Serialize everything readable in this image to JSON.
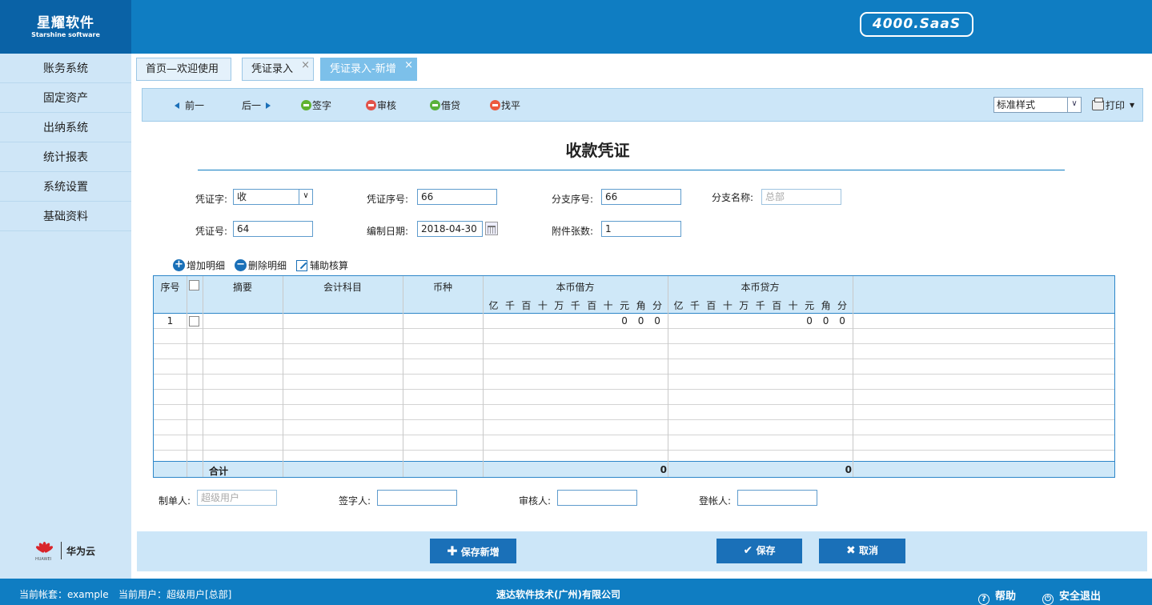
{
  "brand": {
    "name_cn": "星耀软件",
    "name_en": "Starshine software",
    "saas_badge": "4000.SaaS"
  },
  "sidebar": {
    "items": [
      {
        "label": "账务系统"
      },
      {
        "label": "固定资产"
      },
      {
        "label": "出纳系统"
      },
      {
        "label": "统计报表"
      },
      {
        "label": "系统设置"
      },
      {
        "label": "基础资料"
      }
    ],
    "partner": {
      "brand": "HUAWEI",
      "label": "华为云"
    }
  },
  "tabs": [
    {
      "label": "首页—欢迎使用",
      "closable": false,
      "active": false
    },
    {
      "label": "凭证录入",
      "closable": true,
      "active": false
    },
    {
      "label": "凭证录入-新增",
      "closable": true,
      "active": true
    }
  ],
  "toolbar": {
    "prev": "前一",
    "next": "后一",
    "sign": "签字",
    "audit": "审核",
    "debit_credit": "借贷",
    "balance": "找平",
    "style_select": "标准样式",
    "print": "打印"
  },
  "voucher": {
    "title": "收款凭证",
    "fields": {
      "voucher_word_label": "凭证字:",
      "voucher_word_value": "收",
      "voucher_seq_label": "凭证序号:",
      "voucher_seq_value": "66",
      "branch_seq_label": "分支序号:",
      "branch_seq_value": "66",
      "branch_name_label": "分支名称:",
      "branch_name_placeholder": "总部",
      "voucher_no_label": "凭证号:",
      "voucher_no_value": "64",
      "date_label": "编制日期:",
      "date_value": "2018-04-30",
      "attach_label": "附件张数:",
      "attach_value": "1"
    },
    "detail_actions": {
      "add": "增加明细",
      "delete": "删除明细",
      "assist": "辅助核算"
    },
    "grid": {
      "headers": {
        "seq": "序号",
        "summary": "摘要",
        "account": "会计科目",
        "currency": "币种",
        "debit": "本币借方",
        "credit": "本币贷方"
      },
      "digits": [
        "亿",
        "千",
        "百",
        "十",
        "万",
        "千",
        "百",
        "十",
        "元",
        "角",
        "分"
      ],
      "rows": [
        {
          "seq": "1",
          "debit_digits": [
            "0",
            "0",
            "0"
          ],
          "credit_digits": [
            "0",
            "0",
            "0"
          ]
        }
      ],
      "total_label": "合计",
      "total_debit": "0",
      "total_credit": "0"
    },
    "signatures": {
      "maker_label": "制单人:",
      "maker_placeholder": "超级用户",
      "signer_label": "签字人:",
      "auditor_label": "审核人:",
      "poster_label": "登帐人:"
    },
    "buttons": {
      "save_new": "保存新增",
      "save": "保存",
      "cancel": "取消"
    }
  },
  "status_bar": {
    "account_set": "当前帐套：example",
    "current_user": "当前用户：超级用户[总部]",
    "company": "速达软件技术(广州)有限公司",
    "help": "帮助",
    "logout": "安全退出"
  }
}
